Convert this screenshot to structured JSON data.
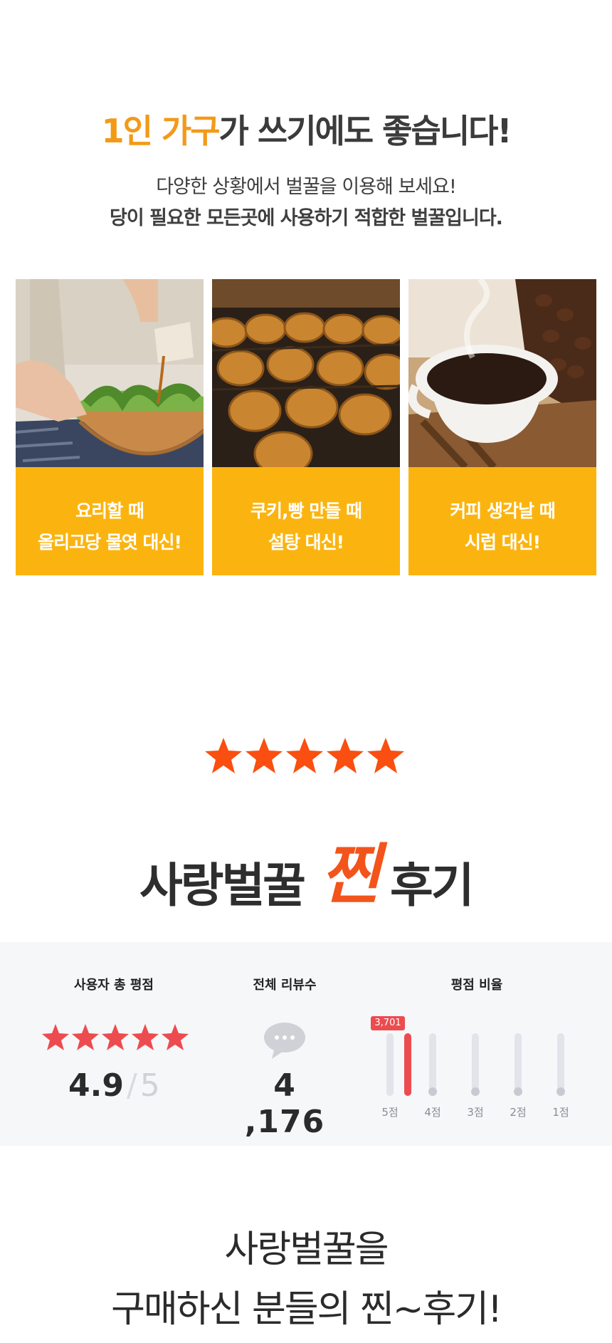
{
  "headline": {
    "highlight": "1인 가구",
    "rest": "가 쓰기에도 좋습니다!"
  },
  "subtext": {
    "line1": "다양한 상황에서 벌꿀을 이용해 보세요!",
    "line2": "당이 필요한 모든곳에 사용하기 적합한 벌꿀입니다."
  },
  "cards": [
    {
      "image": "salad-with-syrup-photo",
      "line1": "요리할 때",
      "line2": "올리고당 물엿 대신!"
    },
    {
      "image": "baked-bread-tray-photo",
      "line1": "쿠키,빵 만들 때",
      "line2": "설탕 대신!"
    },
    {
      "image": "coffee-cup-beans-photo",
      "line1": "커피 생각날 때",
      "line2": "시럽 대신!"
    }
  ],
  "review_title": {
    "before": "사랑벌꿀",
    "accent": "찐",
    "after": "후기"
  },
  "summary": {
    "avg_title": "사용자 총 평점",
    "avg_score": "4.9",
    "avg_separator": "/",
    "avg_max": "5",
    "avg_stars": 5,
    "count_title": "전체 리뷰수",
    "count_value": "4 ,176",
    "ratio_title": "평점 비율",
    "bars": [
      {
        "label": "5점",
        "tip": "3,701",
        "fraction": 1.0
      },
      {
        "label": "4점",
        "tip": "",
        "fraction": 0.0
      },
      {
        "label": "3점",
        "tip": "",
        "fraction": 0.0
      },
      {
        "label": "2점",
        "tip": "",
        "fraction": 0.0
      },
      {
        "label": "1점",
        "tip": "",
        "fraction": 0.0
      }
    ]
  },
  "closing": {
    "line1": "사랑벌꿀을",
    "line2": "구매하신 분들의 찐~후기!"
  },
  "colors": {
    "accent_orange": "#f29a18",
    "card_yellow": "#fbb40f",
    "star_orange": "#fa4f10",
    "star_red": "#ec4c4f"
  }
}
